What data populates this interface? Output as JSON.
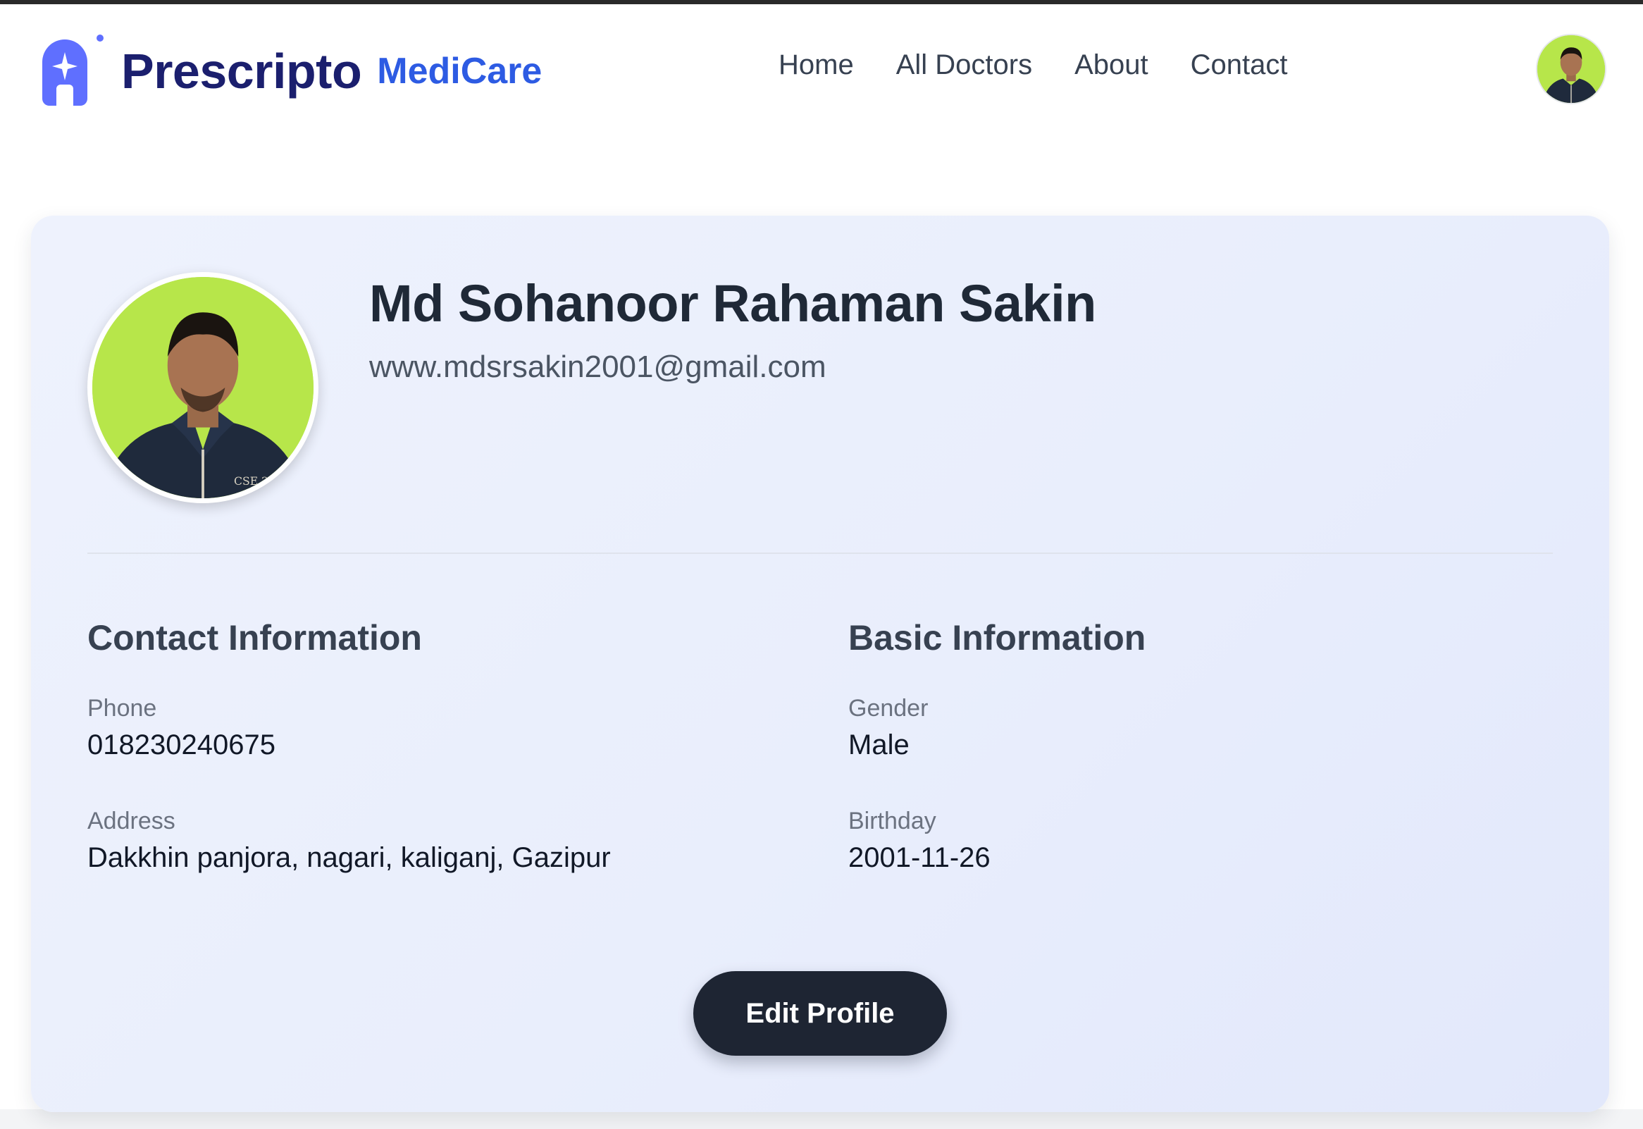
{
  "header": {
    "brand": "Prescripto",
    "brand_sub": "MediCare",
    "nav": [
      "Home",
      "All Doctors",
      "About",
      "Contact"
    ]
  },
  "profile": {
    "name": "Md Sohanoor Rahaman Sakin",
    "email": "www.mdsrsakin2001@gmail.com",
    "contact": {
      "title": "Contact Information",
      "phone_label": "Phone",
      "phone": "018230240675",
      "address_label": "Address",
      "address": "Dakkhin panjora, nagari, kaliganj, Gazipur"
    },
    "basic": {
      "title": "Basic Information",
      "gender_label": "Gender",
      "gender": "Male",
      "birthday_label": "Birthday",
      "birthday": "2001-11-26"
    },
    "edit_button": "Edit Profile"
  },
  "colors": {
    "brand": "#1b1f6e",
    "accent": "#2d5be3",
    "logo": "#5f6fff",
    "avatar_bg": "#b7e64a",
    "button": "#1e2533"
  },
  "icons": [
    "prescripto-logo-icon",
    "user-avatar"
  ]
}
